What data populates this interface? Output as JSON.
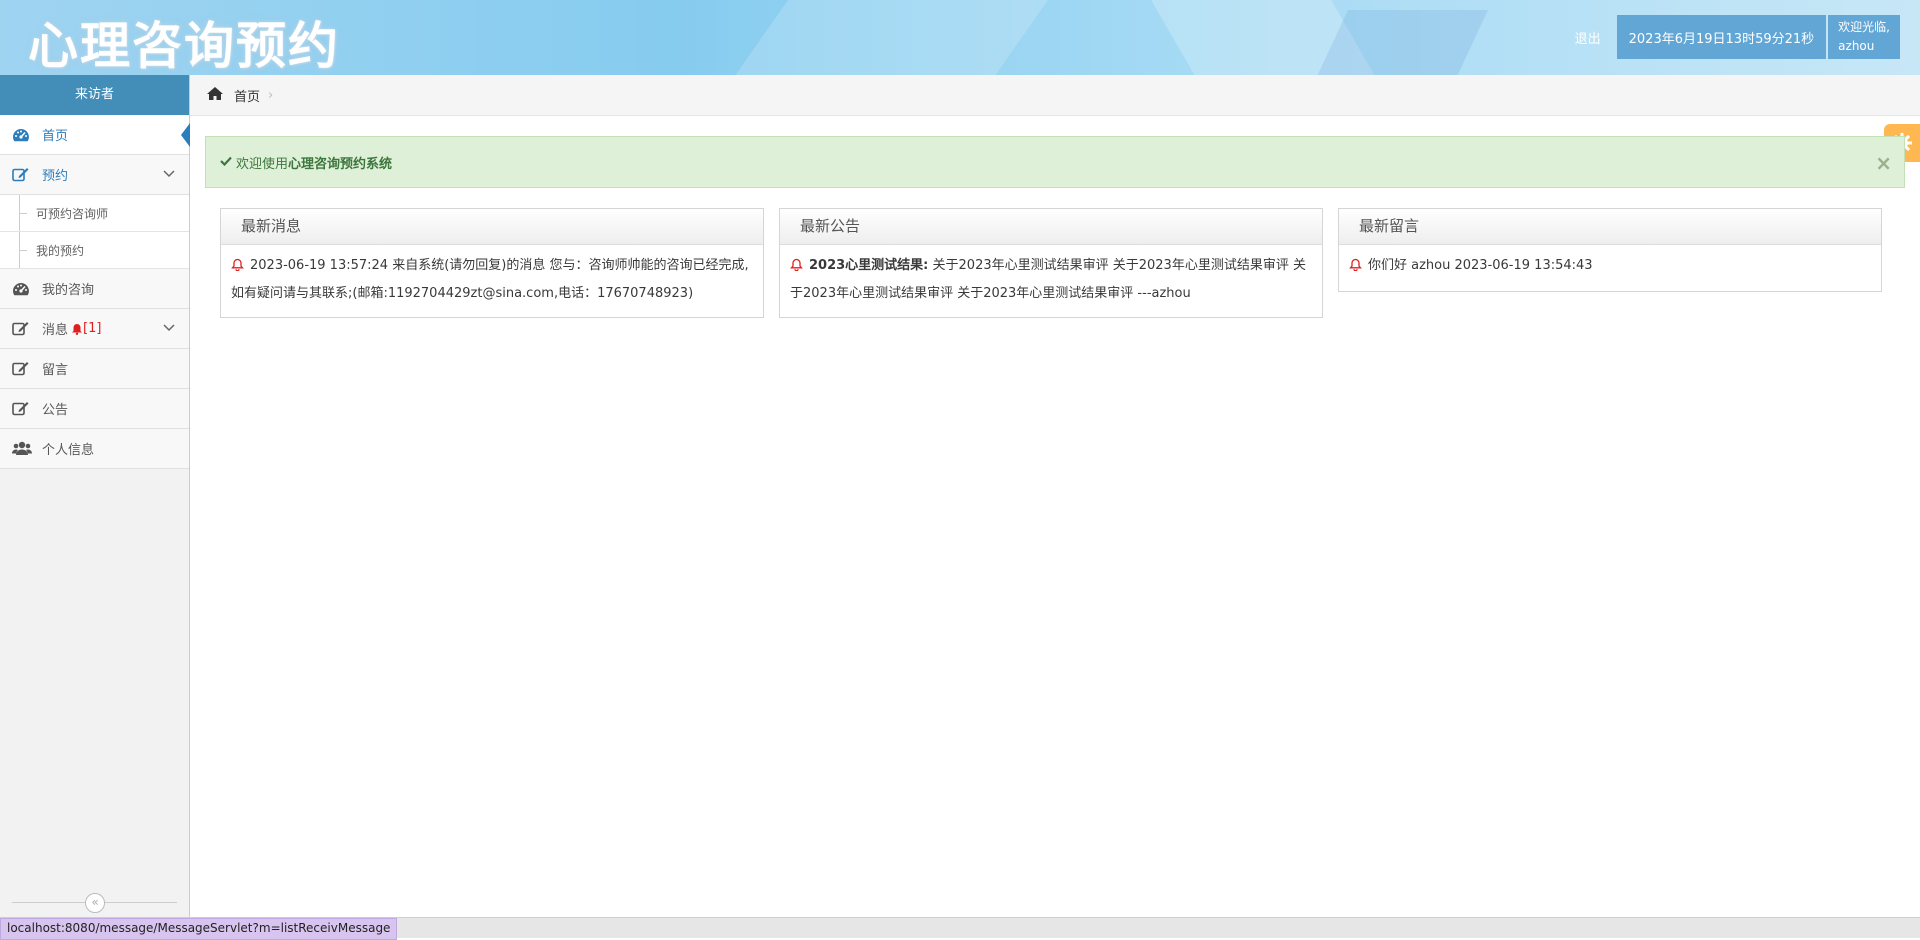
{
  "header": {
    "logo": "心理咨询预约",
    "logout": "退出",
    "datetime": "2023年6月19日13时59分21秒",
    "welcome_line1": "欢迎光临,",
    "welcome_user": "azhou"
  },
  "sidebar": {
    "title": "来访者",
    "items": {
      "home": "首页",
      "booking": "预约",
      "booking_sub1": "可预约咨询师",
      "booking_sub2": "我的预约",
      "consult": "我的咨询",
      "message": "消息",
      "message_badge": "[1]",
      "guestbook": "留言",
      "notice": "公告",
      "profile": "个人信息"
    }
  },
  "breadcrumb": {
    "home": "首页"
  },
  "alert": {
    "prefix": "欢迎使用",
    "system_name": "心理咨询预约系统"
  },
  "widgets": {
    "messages": {
      "title": "最新消息",
      "entry": "2023-06-19 13:57:24   来自系统(请勿回复)的消息  您与：咨询师帅能的咨询已经完成,如有疑问请与其联系;(邮箱:1192704429zt@sina.com,电话：17670748923)"
    },
    "notices": {
      "title": "最新公告",
      "entry_title": "2023心里测试结果:",
      "entry_body": "关于2023年心里测试结果审评 关于2023年心里测试结果审评 关于2023年心里测试结果审评 关于2023年心里测试结果审评 ---azhou"
    },
    "guestbook": {
      "title": "最新留言",
      "entry": "你们好   azhou 2023-06-19 13:54:43"
    }
  },
  "statusbar": {
    "url": "localhost:8080/message/MessageServlet?m=listReceivMessage"
  },
  "colors": {
    "sidebar_head": "#438eb9",
    "active": "#2b7dbc",
    "alert_bg": "#dff0d8",
    "badge": "#e02020"
  }
}
